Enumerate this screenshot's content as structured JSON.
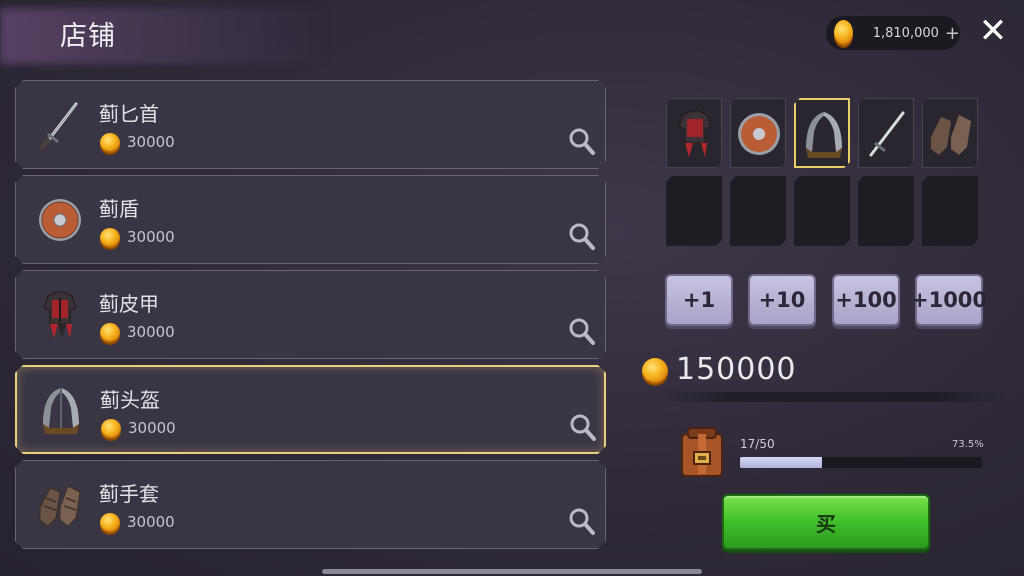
{
  "header": {
    "title": "店铺",
    "currency_amount": "1,810,000",
    "currency_plus": "+",
    "close_label": "✕"
  },
  "items": [
    {
      "name": "蓟匕首",
      "price": "30000",
      "icon": "dagger-icon"
    },
    {
      "name": "蓟盾",
      "price": "30000",
      "icon": "round-shield-icon"
    },
    {
      "name": "蓟皮甲",
      "price": "30000",
      "icon": "leather-armor-icon"
    },
    {
      "name": "蓟头盔",
      "price": "30000",
      "icon": "helmet-icon",
      "selected": true
    },
    {
      "name": "蓟手套",
      "price": "30000",
      "icon": "gauntlets-icon"
    }
  ],
  "preview_slots": [
    "leather-armor-icon",
    "round-shield-icon",
    "helmet-icon",
    "dagger-icon",
    "gauntlets-icon",
    "",
    "",
    "",
    "",
    ""
  ],
  "selected_slot_index": 2,
  "quantity_buttons": [
    "+1",
    "+10",
    "+100",
    "+1000"
  ],
  "total": {
    "amount": "150000"
  },
  "inventory": {
    "text": "17/50",
    "percent_text": "73.5%",
    "fill_fraction": 0.34
  },
  "buy_label": "买",
  "colors": {
    "selected_border": "#e9cf7e",
    "buy_green": "#3fbf2a",
    "coin_gold": "#f7b41f"
  }
}
